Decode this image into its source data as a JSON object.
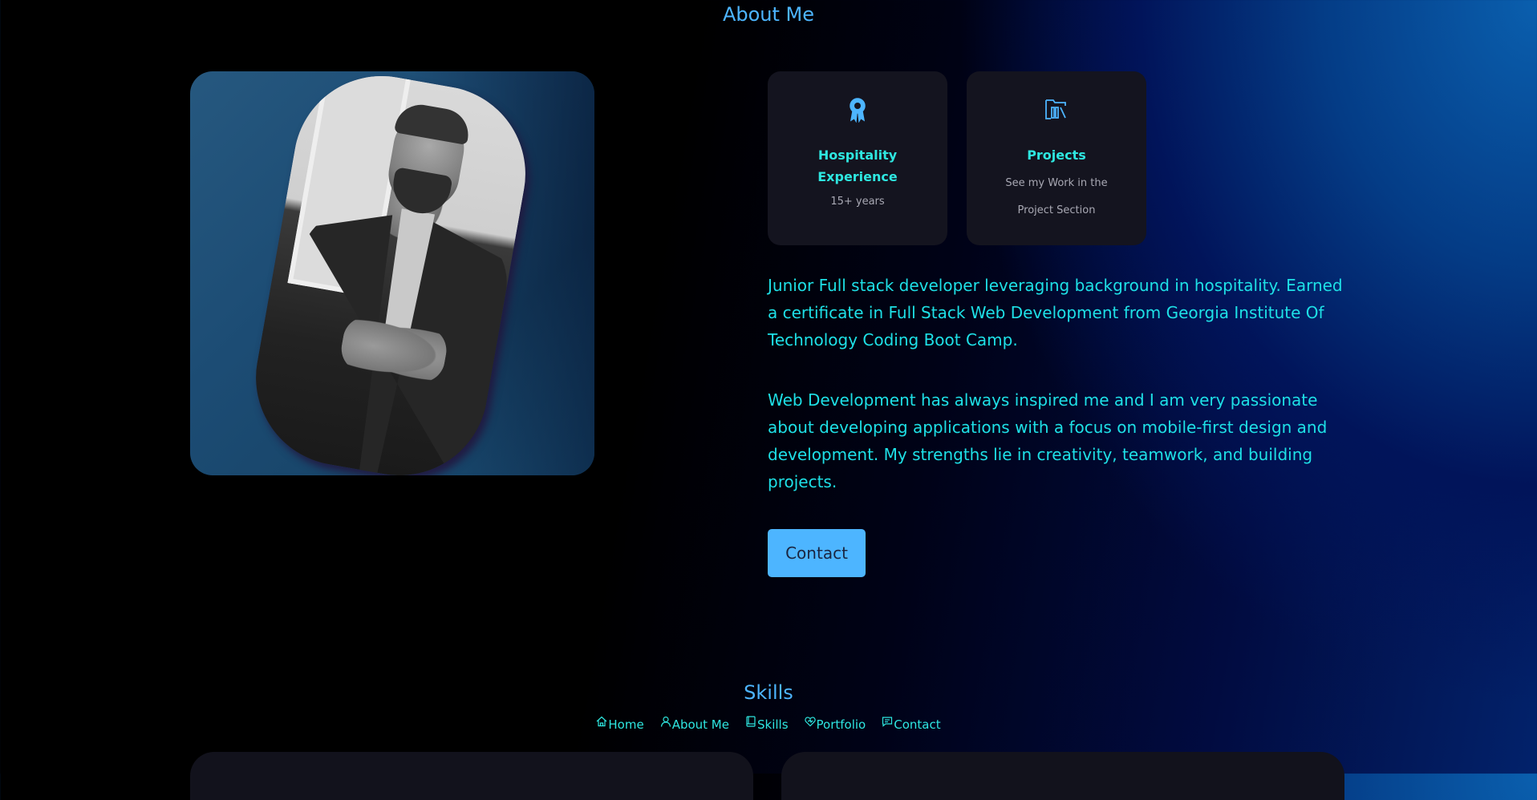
{
  "about": {
    "title": "About Me",
    "cards": [
      {
        "icon": "award-icon",
        "title_line1": "Hospitality",
        "title_line2": "Experience",
        "text": "15+ years"
      },
      {
        "icon": "folder-library-icon",
        "title": "Projects",
        "text": "See my Work in the Project Section"
      }
    ],
    "paragraph1": "Junior Full stack developer leveraging background in hospitality. Earned a certificate in Full Stack Web Development from Georgia Institute Of Technology Coding Boot Camp.",
    "paragraph2": "Web Development has always inspired me and I am very passionate about developing applications with a focus on mobile-first design and development. My strengths lie in creativity, teamwork, and building projects.",
    "contact_label": "Contact"
  },
  "skills": {
    "title": "Skills"
  },
  "nav": {
    "items": [
      {
        "label": "Home",
        "icon": "home-icon"
      },
      {
        "label": "About Me",
        "icon": "user-icon"
      },
      {
        "label": "Skills",
        "icon": "book-icon"
      },
      {
        "label": "Portfolio",
        "icon": "heart-icon"
      },
      {
        "label": "Contact",
        "icon": "message-icon"
      }
    ]
  },
  "colors": {
    "accent": "#4db5ff",
    "text_cyan": "#1ee0e6",
    "card_bg": "#14141f"
  }
}
